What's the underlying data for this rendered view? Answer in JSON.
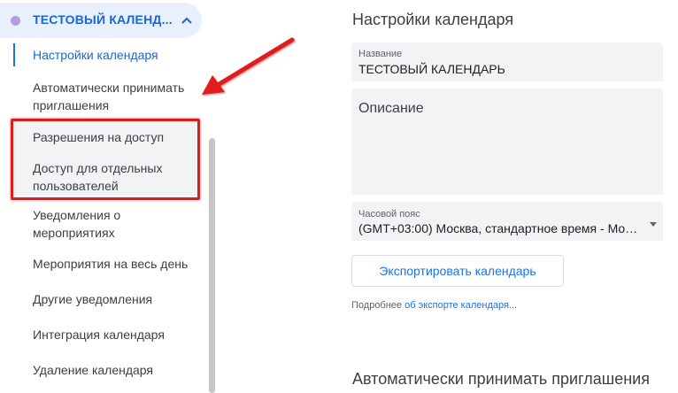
{
  "calendar": {
    "name": "ТЕСТОВЫЙ КАЛЕНД...",
    "dot_color": "#b39ddb",
    "chevron_icon": "chevron-up-icon"
  },
  "sidebar": {
    "items": [
      {
        "label": "Настройки календаря",
        "active": true
      },
      {
        "label": "Автоматически принимать приглашения"
      },
      {
        "label": "Разрешения на доступ"
      },
      {
        "label": "Доступ для отдельных пользователей"
      },
      {
        "label": "Уведомления о мероприятиях"
      },
      {
        "label": "Мероприятия на весь день"
      },
      {
        "label": "Другие уведомления"
      },
      {
        "label": "Интеграция календаря"
      },
      {
        "label": "Удаление календаря"
      }
    ]
  },
  "main": {
    "title": "Настройки календаря",
    "name_field": {
      "label": "Название",
      "value": "ТЕСТОВЫЙ КАЛЕНДАРЬ"
    },
    "description_field": {
      "placeholder": "Описание"
    },
    "timezone_field": {
      "label": "Часовой пояс",
      "value": "(GMT+03:00) Москва, стандартное время - Мос..."
    },
    "export_button": "Экспортировать календарь",
    "more_prefix": "Подробнее",
    "more_link": "об экспорте календаря...",
    "section2_title": "Автоматически принимать приглашения"
  },
  "annotation": {
    "color": "#e01b1b"
  }
}
